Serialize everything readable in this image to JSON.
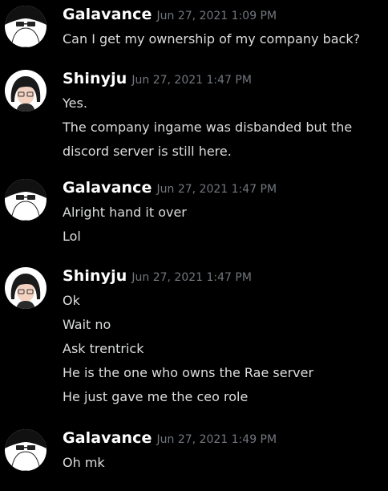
{
  "messages": [
    {
      "author": "Galavance",
      "avatar_icon": "masked-avatar-icon",
      "timestamp": "Jun 27, 2021 1:09 PM",
      "lines": [
        "Can I get my ownership of my company back?"
      ]
    },
    {
      "author": "Shinyju",
      "avatar_icon": "anime-girl-avatar-icon",
      "timestamp": "Jun 27, 2021 1:47 PM",
      "lines": [
        "Yes.",
        "The company ingame was disbanded but the",
        "discord server is still here."
      ]
    },
    {
      "author": "Galavance",
      "avatar_icon": "masked-avatar-icon",
      "timestamp": "Jun 27, 2021 1:47 PM",
      "lines": [
        "Alright hand it over",
        "Lol"
      ]
    },
    {
      "author": "Shinyju",
      "avatar_icon": "anime-girl-avatar-icon",
      "timestamp": "Jun 27, 2021 1:47 PM",
      "lines": [
        "Ok",
        "Wait no",
        "Ask trentrick",
        "He is the one who owns the Rae server",
        "He just gave me the ceo role"
      ]
    },
    {
      "author": "Galavance",
      "avatar_icon": "masked-avatar-icon",
      "timestamp": "Jun 27, 2021 1:49 PM",
      "lines": [
        "Oh mk"
      ]
    }
  ],
  "colors": {
    "background": "#000000",
    "author": "#ffffff",
    "timestamp": "#72767d",
    "message_text": "#dcddde"
  }
}
